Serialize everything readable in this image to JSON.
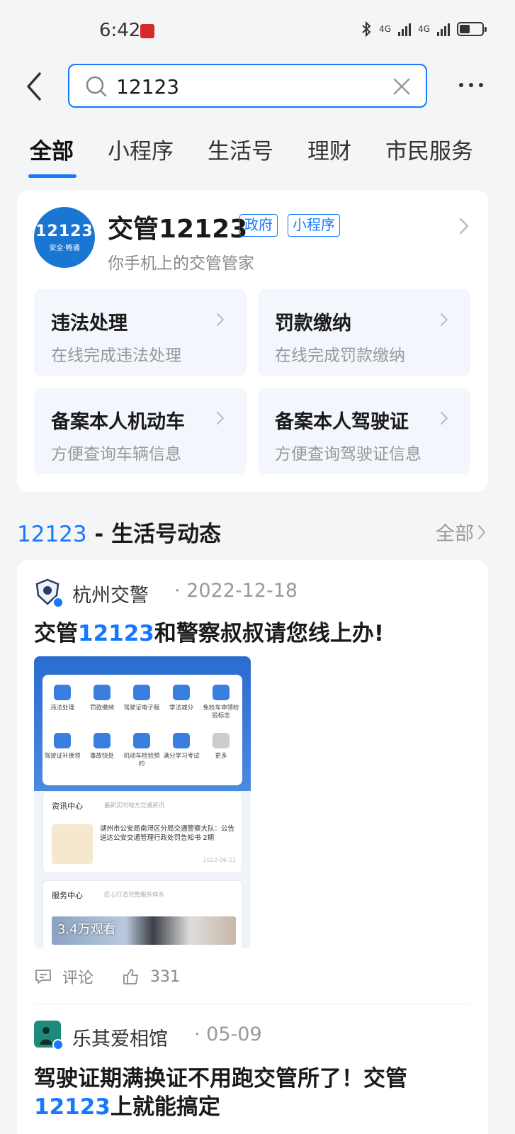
{
  "status_bar": {
    "time": "6:42",
    "net1": "4G",
    "net2": "4G"
  },
  "search": {
    "query": "12123",
    "placeholder": ""
  },
  "tabs": [
    {
      "label": "全部",
      "active": true
    },
    {
      "label": "小程序"
    },
    {
      "label": "生活号"
    },
    {
      "label": "理财"
    },
    {
      "label": "市民服务"
    }
  ],
  "mini_program": {
    "logo_text": "12123",
    "logo_slogan": "安全·畅通",
    "name": "交管12123",
    "tags": [
      "政府",
      "小程序"
    ],
    "subtitle": "你手机上的交管管家",
    "services": [
      {
        "title": "违法处理",
        "sub": "在线完成违法处理"
      },
      {
        "title": "罚款缴纳",
        "sub": "在线完成罚款缴纳"
      },
      {
        "title": "备案本人机动车",
        "sub": "方便查询车辆信息"
      },
      {
        "title": "备案本人驾驶证",
        "sub": "方便查询驾驶证信息"
      }
    ]
  },
  "section": {
    "keyword": "12123",
    "title": " - 生活号动态",
    "all_label": "全部"
  },
  "posts": [
    {
      "author": "杭州交警",
      "date": "· 2022-12-18",
      "title_pre": "交管",
      "title_hl": "12123",
      "title_post": "和警察叔叔请您线上办!",
      "image": {
        "grid": [
          "违法处理",
          "罚款缴纳",
          "驾驶证电子版",
          "学法减分",
          "免检车申领检验标志",
          "驾驶证补换领",
          "事故快处",
          "机动车检验预约",
          "满分学习考试",
          "更多"
        ],
        "news_title": "资讯中心",
        "news_sub": "最新实时地方交通资讯",
        "news_text": "湖州市公安局南浔区分局交通警察大队：公告送达公安交通管理行政处罚告知书 2期",
        "news_date": "2022-06-21",
        "service_title": "服务中心",
        "service_sub": "匠心打造完整服务体系",
        "views": "3.4万观看"
      },
      "comment_label": "评论",
      "likes": "331"
    },
    {
      "author": "乐其爱相馆",
      "date": "· 05-09",
      "title_line1": "驾驶证期满换证不用跑交管所了！交管",
      "title_line2_hl": "12123",
      "title_line2": "上就能搞定"
    }
  ],
  "colors": {
    "accent": "#1677ff",
    "background": "#f4f5f7"
  }
}
